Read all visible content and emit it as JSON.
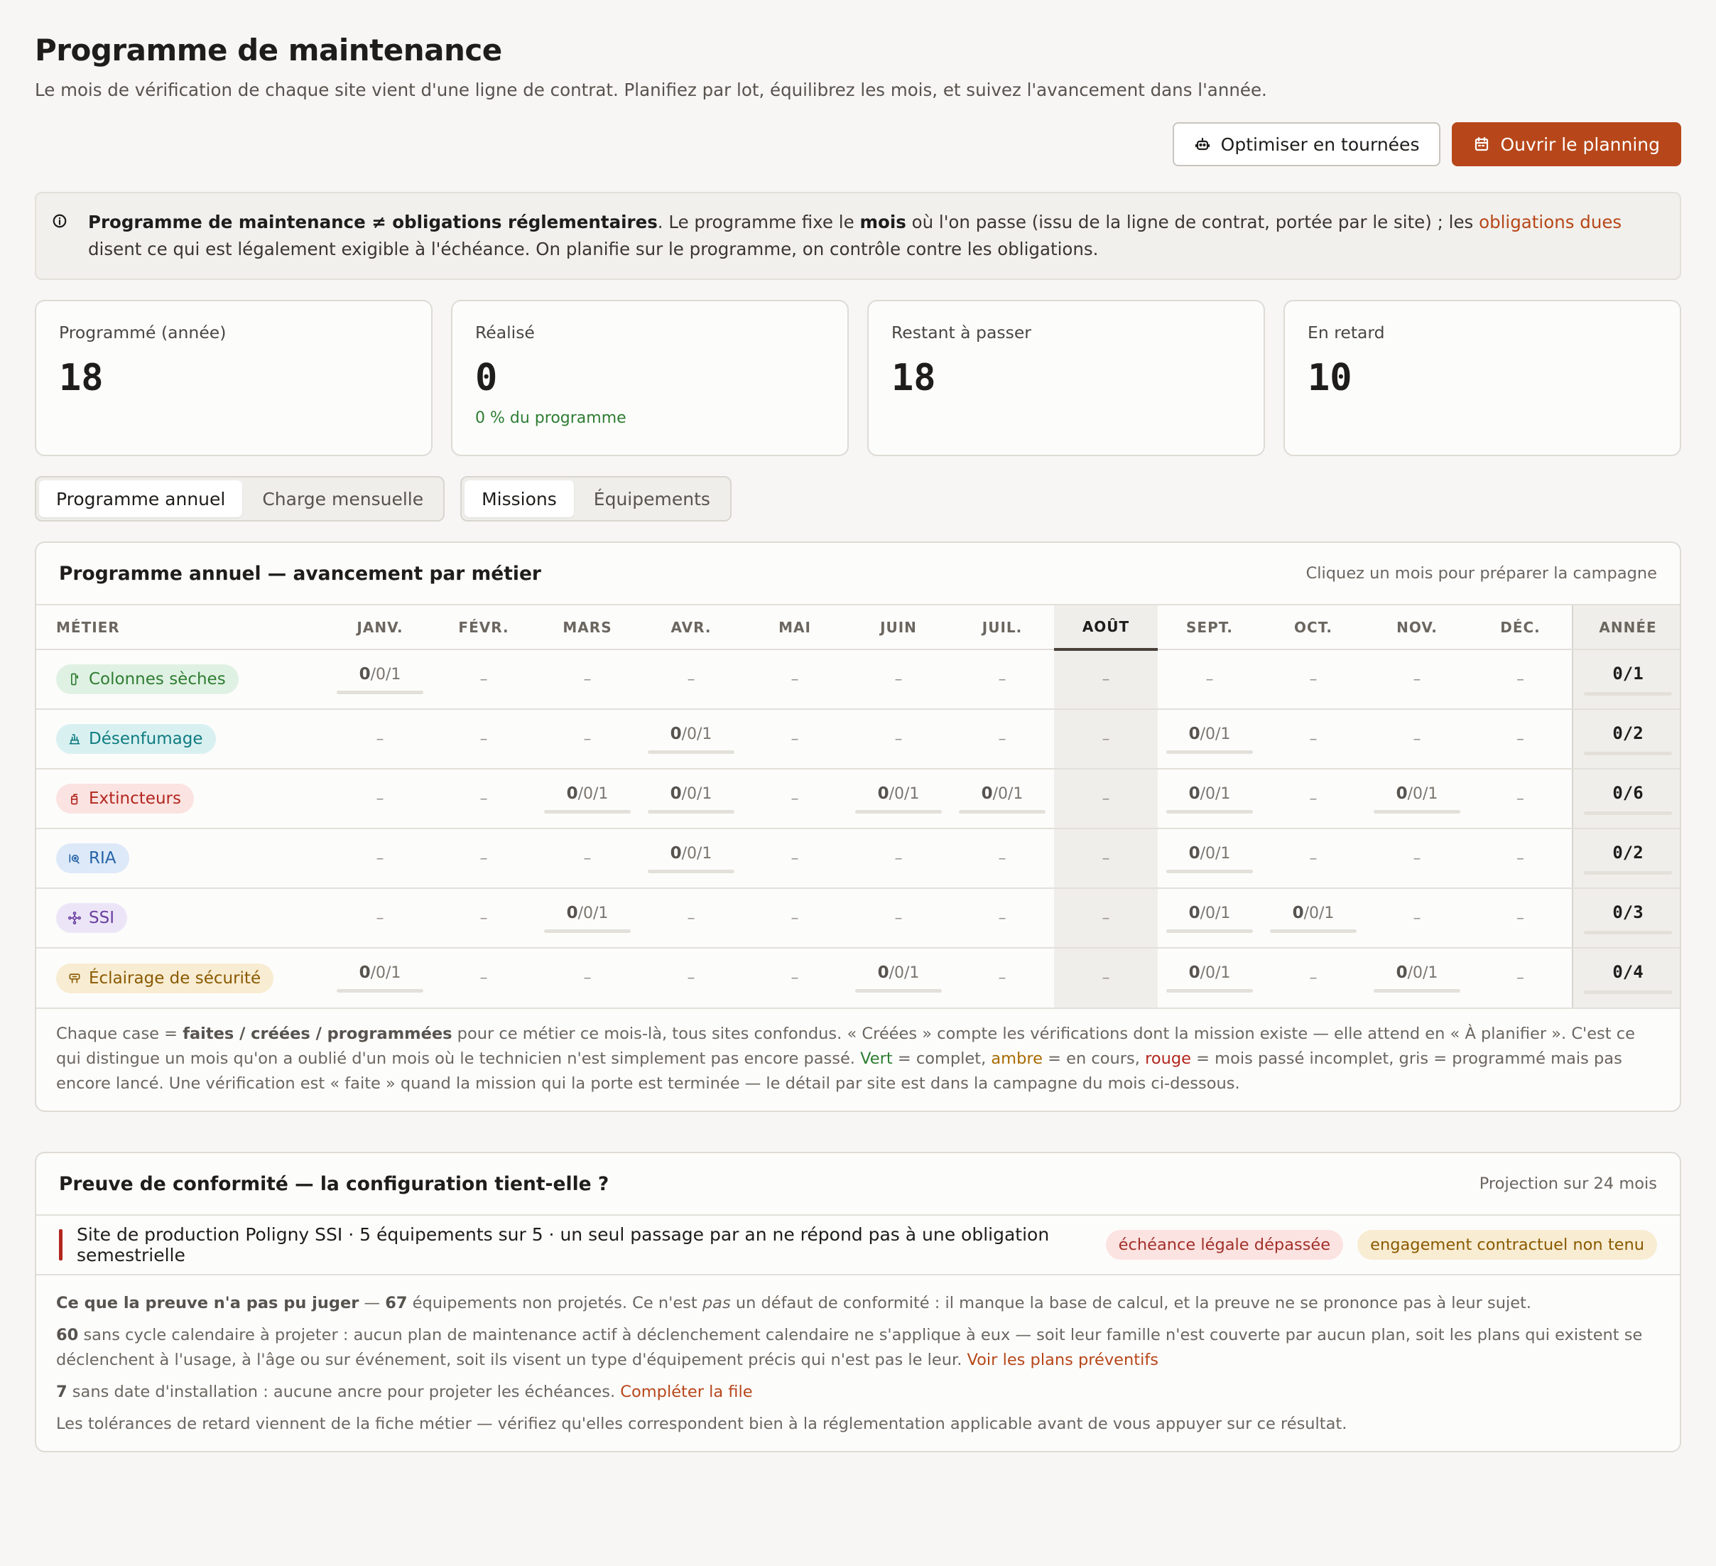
{
  "header": {
    "title": "Programme de maintenance",
    "subtitle": "Le mois de vérification de chaque site vient d'une ligne de contrat. Planifiez par lot, équilibrez les mois, et suivez l'avancement dans l'année."
  },
  "actions": {
    "optimize_label": "Optimiser en tournées",
    "planning_label": "Ouvrir le planning"
  },
  "notice": {
    "bold_title": "Programme de maintenance ≠ obligations réglementaires",
    "text_1": ". Le programme fixe le ",
    "bold_mois": "mois",
    "text_2": " où l'on passe (issu de la ligne de contrat, portée par le site) ; les ",
    "link": "obligations dues",
    "text_3": " disent ce qui est légalement exigible à l'échéance. On planifie sur le programme, on contrôle contre les obligations."
  },
  "stats": [
    {
      "label": "Programmé (année)",
      "value": "18",
      "sub": ""
    },
    {
      "label": "Réalisé",
      "value": "0",
      "sub": "0 % du programme"
    },
    {
      "label": "Restant à passer",
      "value": "18",
      "sub": ""
    },
    {
      "label": "En retard",
      "value": "10",
      "sub": ""
    }
  ],
  "view_tabs": [
    {
      "label": "Programme annuel",
      "active": true
    },
    {
      "label": "Charge mensuelle",
      "active": false
    }
  ],
  "type_tabs": [
    {
      "label": "Missions",
      "active": true
    },
    {
      "label": "Équipements",
      "active": false
    }
  ],
  "annual": {
    "title": "Programme annuel — avancement par métier",
    "hint": "Cliquez un mois pour préparer la campagne",
    "col_metier": "MÉTIER",
    "months": [
      "JANV.",
      "FÉVR.",
      "MARS",
      "AVR.",
      "MAI",
      "JUIN",
      "JUIL.",
      "AOÛT",
      "SEPT.",
      "OCT.",
      "NOV.",
      "DÉC."
    ],
    "current_month_index": 7,
    "col_year": "ANNÉE",
    "empty_mark": "–",
    "rows": [
      {
        "name": "Colonnes sèches",
        "icon": "standpipe-icon",
        "bg": "#dff1e3",
        "fg": "#2e7d32",
        "cells": [
          "0/0/1",
          "",
          "",
          "",
          "",
          "",
          "",
          "",
          "",
          "",
          "",
          ""
        ],
        "year": "0/1"
      },
      {
        "name": "Désenfumage",
        "icon": "smoke-vent-icon",
        "bg": "#d9f0f1",
        "fg": "#0f7c80",
        "cells": [
          "",
          "",
          "",
          "0/0/1",
          "",
          "",
          "",
          "",
          "0/0/1",
          "",
          "",
          ""
        ],
        "year": "0/2"
      },
      {
        "name": "Extincteurs",
        "icon": "extinguisher-icon",
        "bg": "#fbe3e1",
        "fg": "#b3261e",
        "cells": [
          "",
          "",
          "0/0/1",
          "0/0/1",
          "",
          "0/0/1",
          "0/0/1",
          "",
          "0/0/1",
          "",
          "0/0/1",
          ""
        ],
        "year": "0/6"
      },
      {
        "name": "RIA",
        "icon": "fire-hose-icon",
        "bg": "#dde9f8",
        "fg": "#2563a8",
        "cells": [
          "",
          "",
          "",
          "0/0/1",
          "",
          "",
          "",
          "",
          "0/0/1",
          "",
          "",
          ""
        ],
        "year": "0/2"
      },
      {
        "name": "SSI",
        "icon": "network-icon",
        "bg": "#ece5f7",
        "fg": "#6b3fa0",
        "cells": [
          "",
          "",
          "0/0/1",
          "",
          "",
          "",
          "",
          "",
          "0/0/1",
          "0/0/1",
          "",
          ""
        ],
        "year": "0/3"
      },
      {
        "name": "Éclairage de sécurité",
        "icon": "emergency-light-icon",
        "bg": "#f8ecd2",
        "fg": "#8a5a00",
        "cells": [
          "0/0/1",
          "",
          "",
          "",
          "",
          "0/0/1",
          "",
          "",
          "0/0/1",
          "",
          "0/0/1",
          ""
        ],
        "year": "0/4"
      }
    ],
    "legend": {
      "p1": "Chaque case = ",
      "b1": "faites / créées / programmées",
      "p2": " pour ce métier ce mois-là, tous sites confondus. « Créées » compte les vérifications dont la mission existe — elle attend en « À planifier ». C'est ce qui distingue un mois qu'on a oublié d'un mois où le technicien n'est simplement pas encore passé. ",
      "green": "Vert",
      "p3": " = complet, ",
      "amber": "ambre",
      "p4": " = en cours, ",
      "red": "rouge",
      "p5": " = mois passé incomplet, gris = programmé mais pas encore lancé. Une vérification est « faite » quand la mission qui la porte est terminée — le détail par site est dans la campagne du mois ci-dessous."
    }
  },
  "proof": {
    "title": "Preuve de conformité — la configuration tient-elle ?",
    "hint": "Projection sur 24 mois",
    "finding": "Site de production Poligny SSI · 5 équipements sur 5 · un seul passage par an ne répond pas à une obligation semestrielle",
    "badge_legal": "échéance légale dépassée",
    "badge_contract": "engagement contractuel non tenu",
    "unjudged_bold": "Ce que la preuve n'a pas pu juger",
    "unjudged_dash": " — ",
    "unjudged_count": "67",
    "unjudged_text_1": " équipements non projetés. Ce n'est ",
    "unjudged_em": "pas",
    "unjudged_text_2": " un défaut de conformité : il manque la base de calcul, et la preuve ne se prononce pas à leur sujet.",
    "no_cycle_count": "60",
    "no_cycle_text": " sans cycle calendaire à projeter : aucun plan de maintenance actif à déclenchement calendaire ne s'applique à eux — soit leur famille n'est couverte par aucun plan, soit les plans qui existent se déclenchent à l'usage, à l'âge ou sur événement, soit ils visent un type d'équipement précis qui n'est pas le leur. ",
    "no_cycle_link": "Voir les plans préventifs",
    "no_date_count": "7",
    "no_date_text": " sans date d'installation : aucune ancre pour projeter les échéances. ",
    "no_date_link": "Compléter la file",
    "tolerance_note": "Les tolérances de retard viennent de la fiche métier — vérifiez qu'elles correspondent bien à la réglementation applicable avant de vous appuyer sur ce résultat."
  }
}
